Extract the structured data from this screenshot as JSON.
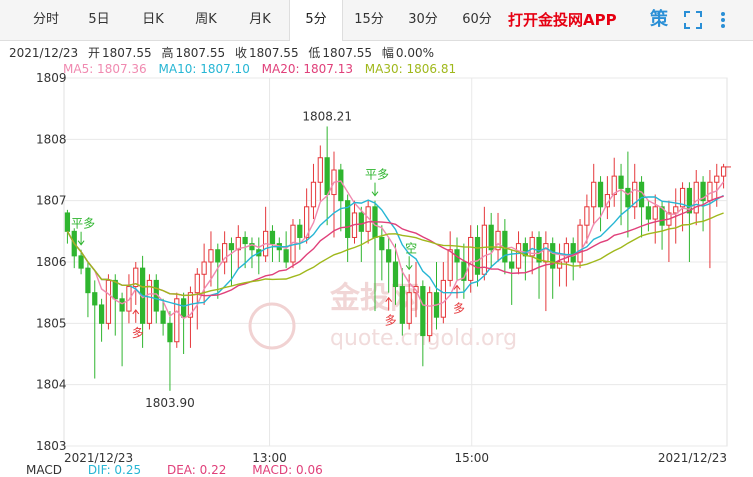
{
  "tabs": [
    {
      "label": "分时"
    },
    {
      "label": "5日"
    },
    {
      "label": "日K"
    },
    {
      "label": "周K"
    },
    {
      "label": "月K"
    },
    {
      "label": "5分",
      "active": true
    },
    {
      "label": "15分"
    },
    {
      "label": "30分"
    },
    {
      "label": "60分"
    }
  ],
  "promo": "打开金投网APP",
  "tools": {
    "brand_glyph": "策",
    "fullscreen_icon": "fullscreen-icon",
    "more_icon": "more-vertical-icon"
  },
  "info": {
    "date": "2021/12/23",
    "open_label": "开",
    "open": "1807.55",
    "high_label": "高",
    "high": "1807.55",
    "close_label": "收",
    "close": "1807.55",
    "low_label": "低",
    "low": "1807.55",
    "change_label": "幅",
    "change": "0.00%"
  },
  "ma": [
    {
      "label": "MA5: 1807.36",
      "color": "#f08ab0"
    },
    {
      "label": "MA10: 1807.10",
      "color": "#27b6d4"
    },
    {
      "label": "MA20: 1807.13",
      "color": "#e0407a"
    },
    {
      "label": "MA30: 1806.81",
      "color": "#a0b81c"
    }
  ],
  "footer": [
    {
      "label": "MACD",
      "color": "#333333"
    },
    {
      "label": "DIF: 0.25",
      "color": "#27b6d4"
    },
    {
      "label": "DEA: 0.22",
      "color": "#e0407a"
    },
    {
      "label": "MACD: 0.06",
      "color": "#e0407a"
    }
  ],
  "chart_data": {
    "type": "candlestick",
    "ylim": [
      1803,
      1809
    ],
    "y_ticks": [
      "1809",
      "1808",
      "1807",
      "1806",
      "1805",
      "1804",
      "1803"
    ],
    "x_labels": [
      "2021/12/23",
      "13:00",
      "15:00",
      "2021/12/23"
    ],
    "annotations": {
      "high": "1808.21",
      "low": "1803.90"
    },
    "signals": [
      "平多",
      "多",
      "平多",
      "多",
      "空",
      "多"
    ],
    "watermark": "金投网 quote.cngold.org",
    "colors": {
      "up": "#e5383b",
      "down": "#2fb52f"
    },
    "series_colors": [
      "#f08ab0",
      "#27b6d4",
      "#e0407a",
      "#a0b81c"
    ],
    "candles": [
      [
        1806.8,
        1806.5,
        1806.85,
        1806.3
      ],
      [
        1806.5,
        1806.1,
        1806.55,
        1805.9
      ],
      [
        1806.1,
        1805.9,
        1806.2,
        1805.8
      ],
      [
        1805.9,
        1805.5,
        1806.0,
        1805.1
      ],
      [
        1805.5,
        1805.3,
        1805.7,
        1804.1
      ],
      [
        1805.3,
        1805.0,
        1805.4,
        1804.7
      ],
      [
        1805.0,
        1805.7,
        1805.8,
        1804.9
      ],
      [
        1805.7,
        1805.4,
        1805.8,
        1804.8
      ],
      [
        1805.4,
        1805.2,
        1805.5,
        1804.3
      ],
      [
        1805.2,
        1805.6,
        1805.8,
        1805.0
      ],
      [
        1805.6,
        1805.9,
        1806.0,
        1805.3
      ],
      [
        1805.9,
        1805.0,
        1806.1,
        1804.6
      ],
      [
        1805.0,
        1805.7,
        1805.8,
        1804.9
      ],
      [
        1805.7,
        1805.2,
        1805.8,
        1805.0
      ],
      [
        1805.2,
        1805.0,
        1805.4,
        1804.8
      ],
      [
        1805.0,
        1804.7,
        1805.2,
        1803.9
      ],
      [
        1804.7,
        1805.4,
        1805.5,
        1804.6
      ],
      [
        1805.4,
        1805.1,
        1805.5,
        1804.5
      ],
      [
        1805.1,
        1805.5,
        1805.6,
        1804.6
      ],
      [
        1805.5,
        1805.8,
        1805.9,
        1804.9
      ],
      [
        1805.8,
        1806.0,
        1806.3,
        1805.3
      ],
      [
        1806.0,
        1806.2,
        1806.5,
        1805.6
      ],
      [
        1806.2,
        1806.0,
        1806.3,
        1805.4
      ],
      [
        1806.0,
        1806.3,
        1806.5,
        1805.8
      ],
      [
        1806.3,
        1806.2,
        1806.4,
        1805.6
      ],
      [
        1806.2,
        1806.4,
        1806.6,
        1805.9
      ],
      [
        1806.4,
        1806.3,
        1806.5,
        1805.9
      ],
      [
        1806.3,
        1806.2,
        1806.4,
        1805.9
      ],
      [
        1806.2,
        1806.1,
        1806.4,
        1805.8
      ],
      [
        1806.1,
        1806.5,
        1806.9,
        1806.0
      ],
      [
        1806.5,
        1806.3,
        1806.6,
        1806.0
      ],
      [
        1806.3,
        1806.2,
        1806.4,
        1806.0
      ],
      [
        1806.2,
        1806.0,
        1806.5,
        1805.9
      ],
      [
        1806.0,
        1806.6,
        1806.7,
        1805.9
      ],
      [
        1806.6,
        1806.4,
        1806.7,
        1806.2
      ],
      [
        1806.4,
        1806.9,
        1807.2,
        1806.3
      ],
      [
        1806.9,
        1807.3,
        1807.6,
        1806.7
      ],
      [
        1807.3,
        1807.7,
        1807.9,
        1807.0
      ],
      [
        1807.7,
        1807.1,
        1808.21,
        1806.6
      ],
      [
        1807.1,
        1807.5,
        1807.8,
        1806.4
      ],
      [
        1807.5,
        1807.0,
        1807.6,
        1806.5
      ],
      [
        1807.0,
        1806.4,
        1807.1,
        1806.0
      ],
      [
        1806.4,
        1806.8,
        1807.0,
        1806.3
      ],
      [
        1806.8,
        1806.5,
        1806.9,
        1806.0
      ],
      [
        1806.5,
        1806.9,
        1807.0,
        1806.3
      ],
      [
        1806.9,
        1806.4,
        1807.0,
        1805.2
      ],
      [
        1806.4,
        1806.2,
        1806.6,
        1805.7
      ],
      [
        1806.2,
        1806.0,
        1806.4,
        1805.5
      ],
      [
        1806.0,
        1805.6,
        1806.3,
        1805.3
      ],
      [
        1805.6,
        1805.0,
        1805.9,
        1804.8
      ],
      [
        1805.0,
        1805.5,
        1805.8,
        1804.9
      ],
      [
        1805.5,
        1805.6,
        1806.0,
        1805.1
      ],
      [
        1805.6,
        1804.8,
        1805.7,
        1804.3
      ],
      [
        1804.8,
        1805.5,
        1805.6,
        1804.7
      ],
      [
        1805.5,
        1805.1,
        1806.0,
        1804.9
      ],
      [
        1805.1,
        1805.7,
        1806.0,
        1805.0
      ],
      [
        1805.7,
        1806.2,
        1806.5,
        1805.6
      ],
      [
        1806.2,
        1806.0,
        1806.4,
        1805.7
      ],
      [
        1806.0,
        1805.7,
        1806.3,
        1805.4
      ],
      [
        1805.7,
        1806.4,
        1806.6,
        1805.5
      ],
      [
        1806.4,
        1805.8,
        1806.6,
        1805.6
      ],
      [
        1805.8,
        1806.6,
        1806.9,
        1805.7
      ],
      [
        1806.6,
        1806.2,
        1806.8,
        1805.9
      ],
      [
        1806.2,
        1806.5,
        1806.8,
        1806.0
      ],
      [
        1806.5,
        1806.0,
        1806.7,
        1805.8
      ],
      [
        1806.0,
        1805.9,
        1806.2,
        1805.3
      ],
      [
        1805.9,
        1806.3,
        1806.5,
        1805.8
      ],
      [
        1806.3,
        1806.1,
        1806.4,
        1805.7
      ],
      [
        1806.1,
        1806.4,
        1806.5,
        1805.8
      ],
      [
        1806.4,
        1806.0,
        1806.5,
        1805.4
      ],
      [
        1806.0,
        1806.3,
        1806.5,
        1805.2
      ],
      [
        1806.3,
        1805.9,
        1806.4,
        1805.4
      ],
      [
        1805.9,
        1806.0,
        1806.3,
        1805.6
      ],
      [
        1806.0,
        1806.3,
        1806.4,
        1805.6
      ],
      [
        1806.3,
        1806.0,
        1806.4,
        1805.7
      ],
      [
        1806.0,
        1806.6,
        1806.7,
        1805.9
      ],
      [
        1806.6,
        1806.9,
        1807.1,
        1806.3
      ],
      [
        1806.9,
        1807.3,
        1807.6,
        1806.6
      ],
      [
        1807.3,
        1806.9,
        1807.4,
        1806.5
      ],
      [
        1806.9,
        1807.1,
        1807.4,
        1806.7
      ],
      [
        1807.1,
        1807.4,
        1807.7,
        1806.9
      ],
      [
        1807.4,
        1807.2,
        1807.6,
        1806.6
      ],
      [
        1807.2,
        1806.9,
        1807.8,
        1806.4
      ],
      [
        1806.9,
        1807.3,
        1807.6,
        1806.7
      ],
      [
        1807.3,
        1806.9,
        1807.4,
        1806.4
      ],
      [
        1806.9,
        1806.7,
        1807.0,
        1806.5
      ],
      [
        1806.7,
        1806.9,
        1807.1,
        1806.3
      ],
      [
        1806.9,
        1806.6,
        1807.0,
        1806.2
      ],
      [
        1806.6,
        1806.8,
        1807.0,
        1806.0
      ],
      [
        1806.8,
        1806.9,
        1807.2,
        1806.3
      ],
      [
        1806.9,
        1807.2,
        1807.3,
        1806.5
      ],
      [
        1807.2,
        1806.8,
        1807.3,
        1806.0
      ],
      [
        1806.8,
        1807.3,
        1807.5,
        1806.6
      ],
      [
        1807.3,
        1807.0,
        1807.4,
        1806.5
      ],
      [
        1807.0,
        1807.3,
        1807.5,
        1805.9
      ],
      [
        1807.3,
        1807.4,
        1807.6,
        1806.9
      ],
      [
        1807.4,
        1807.55,
        1807.6,
        1807.2
      ]
    ]
  }
}
